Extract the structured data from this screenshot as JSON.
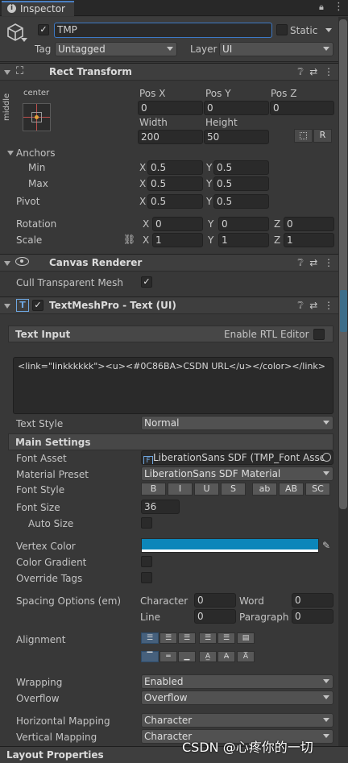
{
  "tab": {
    "title": "Inspector",
    "lock_icon": "lock-icon",
    "menu_icon": "kebab-menu-icon"
  },
  "object": {
    "active": true,
    "name": "TMP",
    "static_label": "Static",
    "tag_label": "Tag",
    "tag_value": "Untagged",
    "layer_label": "Layer",
    "layer_value": "UI"
  },
  "rect_transform": {
    "title": "Rect Transform",
    "anchor_preset_h": "center",
    "anchor_preset_v": "middle",
    "pos_x_label": "Pos X",
    "pos_y_label": "Pos Y",
    "pos_z_label": "Pos Z",
    "pos_x": "0",
    "pos_y": "0",
    "pos_z": "0",
    "width_label": "Width",
    "height_label": "Height",
    "width": "200",
    "height": "50",
    "raw_button": "R",
    "anchors_label": "Anchors",
    "min_label": "Min",
    "max_label": "Max",
    "min_x": "0.5",
    "min_y": "0.5",
    "max_x": "0.5",
    "max_y": "0.5",
    "pivot_label": "Pivot",
    "pivot_x": "0.5",
    "pivot_y": "0.5",
    "rotation_label": "Rotation",
    "rot_x": "0",
    "rot_y": "0",
    "rot_z": "0",
    "scale_label": "Scale",
    "scale_x": "1",
    "scale_y": "1",
    "scale_z": "1",
    "x": "X",
    "y": "Y",
    "z": "Z"
  },
  "canvas_renderer": {
    "title": "Canvas Renderer",
    "cull_label": "Cull Transparent Mesh",
    "cull_checked": true
  },
  "tmp": {
    "title": "TextMeshPro - Text (UI)",
    "enabled": true,
    "text_input_label": "Text Input",
    "rtl_label": "Enable RTL Editor",
    "text": "<link=\"linkkkkkk\"><u><#0C86BA>CSDN URL</u></color></link>",
    "text_style_label": "Text Style",
    "text_style_value": "Normal",
    "main_settings_label": "Main Settings",
    "font_asset_label": "Font Asset",
    "font_asset_value": "LiberationSans SDF (TMP_Font Asse",
    "material_preset_label": "Material Preset",
    "material_preset_value": "LiberationSans SDF Material",
    "font_style_label": "Font Style",
    "font_style_buttons": [
      "B",
      "I",
      "U",
      "S",
      "ab",
      "AB",
      "SC"
    ],
    "font_size_label": "Font Size",
    "font_size_value": "36",
    "auto_size_label": "Auto Size",
    "vertex_color_label": "Vertex Color",
    "vertex_color": "#0C86BA",
    "color_gradient_label": "Color Gradient",
    "override_tags_label": "Override Tags",
    "spacing_label": "Spacing Options (em)",
    "character_label": "Character",
    "character_value": "0",
    "word_label": "Word",
    "word_value": "0",
    "line_label": "Line",
    "line_value": "0",
    "paragraph_label": "Paragraph",
    "paragraph_value": "0",
    "alignment_label": "Alignment",
    "wrapping_label": "Wrapping",
    "wrapping_value": "Enabled",
    "overflow_label": "Overflow",
    "overflow_value": "Overflow",
    "hmap_label": "Horizontal Mapping",
    "hmap_value": "Character",
    "vmap_label": "Vertical Mapping",
    "vmap_value": "Character"
  },
  "footer": {
    "title": "Layout Properties"
  },
  "watermark": "CSDN @心疼你的一切"
}
